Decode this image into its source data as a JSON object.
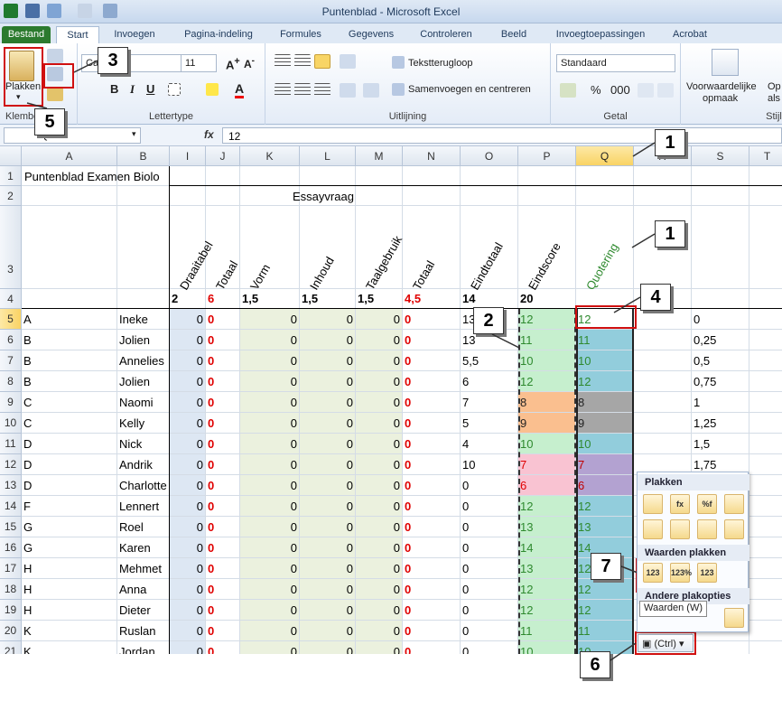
{
  "window": {
    "title": "Puntenblad - Microsoft Excel"
  },
  "tabs": [
    "Bestand",
    "Start",
    "Invoegen",
    "Pagina-indeling",
    "Formules",
    "Gegevens",
    "Controleren",
    "Beeld",
    "Invoegtoepassingen",
    "Acrobat"
  ],
  "ribbon": {
    "paste_label": "Plakken",
    "clipboard_group": "Klembord",
    "font_name": "Ca",
    "font_size": "11",
    "font_group": "Lettertype",
    "wrap_text": "Tekstterugloop",
    "merge_center": "Samenvoegen en centreren",
    "alignment_group": "Uitlijning",
    "number_format": "Standaard",
    "number_group": "Getal",
    "conditional_label": "Voorwaardelijke",
    "conditional_label2": "opmaak",
    "styles_op": "Op",
    "styles_als": "als",
    "styles_group": "Stijle"
  },
  "formula": {
    "namebox": "Q5",
    "fx": "fx",
    "value": "12"
  },
  "columns": [
    "A",
    "B",
    "I",
    "J",
    "K",
    "L",
    "M",
    "N",
    "O",
    "P",
    "Q",
    "R",
    "S",
    "T"
  ],
  "rows_header": [
    "1",
    "2",
    "3",
    "4",
    "5",
    "6",
    "7",
    "8",
    "9",
    "10",
    "11",
    "12",
    "13",
    "14",
    "15",
    "16",
    "17",
    "18",
    "19",
    "20",
    "21"
  ],
  "title_text": "Puntenblad Examen Biolo",
  "essay_label": "Essayvraag",
  "vertical_headers": [
    "Draaitabel",
    "Totaal",
    "Vorm",
    "Inhoud",
    "Taalgebruik",
    "Totaal",
    "Eindtotaal",
    "Eindscore",
    "Quotering"
  ],
  "row4": {
    "i": "2",
    "j": "6",
    "k": "1,5",
    "l": "1,5",
    "m": "1,5",
    "n": "4,5",
    "o": "14",
    "p": "20"
  },
  "students": [
    {
      "a": "A",
      "b": "Ineke",
      "o": "13",
      "p": "12",
      "q": "12",
      "s": "0"
    },
    {
      "a": "B",
      "b": "Jolien",
      "o": "13",
      "p": "11",
      "q": "11",
      "s": "0,25"
    },
    {
      "a": "B",
      "b": "Annelies",
      "o": "5,5",
      "p": "10",
      "q": "10",
      "s": "0,5"
    },
    {
      "a": "B",
      "b": "Jolien",
      "o": "6",
      "p": "12",
      "q": "12",
      "s": "0,75"
    },
    {
      "a": "C",
      "b": "Naomi",
      "o": "7",
      "p": "8",
      "q": "8",
      "s": "1"
    },
    {
      "a": "C",
      "b": "Kelly",
      "o": "5",
      "p": "9",
      "q": "9",
      "s": "1,25"
    },
    {
      "a": "D",
      "b": "Nick",
      "o": "4",
      "p": "10",
      "q": "10",
      "s": "1,5"
    },
    {
      "a": "D",
      "b": "Andrik",
      "o": "10",
      "p": "7",
      "q": "7",
      "s": "1,75"
    },
    {
      "a": "D",
      "b": "Charlotte",
      "o": "0",
      "p": "6",
      "q": "6",
      "s": ""
    },
    {
      "a": "F",
      "b": "Lennert",
      "o": "0",
      "p": "12",
      "q": "12",
      "s": ""
    },
    {
      "a": "G",
      "b": "Roel",
      "o": "0",
      "p": "13",
      "q": "13",
      "s": ""
    },
    {
      "a": "G",
      "b": "Karen",
      "o": "0",
      "p": "14",
      "q": "14",
      "s": ""
    },
    {
      "a": "H",
      "b": "Mehmet",
      "o": "0",
      "p": "13",
      "q": "12",
      "s": ""
    },
    {
      "a": "H",
      "b": "Anna",
      "o": "0",
      "p": "12",
      "q": "12",
      "s": ""
    },
    {
      "a": "H",
      "b": "Dieter",
      "o": "0",
      "p": "12",
      "q": "12",
      "s": ""
    },
    {
      "a": "K",
      "b": "Ruslan",
      "o": "0",
      "p": "11",
      "q": "11",
      "s": ""
    },
    {
      "a": "K",
      "b": "Jordan",
      "o": "0",
      "p": "10",
      "q": "10",
      "s": ""
    }
  ],
  "zero": "0",
  "paste_popup": {
    "section1": "Plakken",
    "section2": "Waarden plakken",
    "section3": "Andere plakopties",
    "tooltip": "Waarden (W)",
    "ctrl": "(Ctrl)",
    "btn_123": "123",
    "btn_123pct": "123%"
  },
  "callouts": [
    "1",
    "1",
    "2",
    "3",
    "4",
    "5",
    "6",
    "7"
  ]
}
